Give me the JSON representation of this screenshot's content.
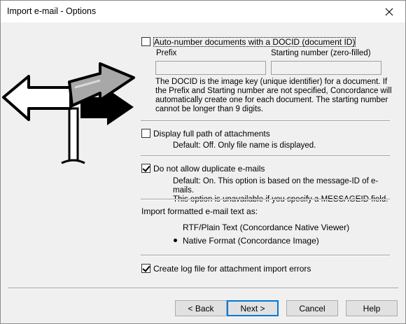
{
  "window": {
    "title": "Import e-mail - Options"
  },
  "autonumber": {
    "label": "Auto-number documents with a DOCID (document ID)",
    "checked": false,
    "prefix_label": "Prefix",
    "prefix_value": "",
    "start_label": "Starting number (zero-filled)",
    "start_value": "",
    "desc_lines": [
      "The DOCID is the image key (unique identifier) for a document. If",
      "the Prefix and Starting number are not specified, Concordance will",
      "automatically create one for each document. The starting number",
      "cannot be longer than 9 digits."
    ]
  },
  "fullpath": {
    "label": "Display full path of attachments",
    "checked": false,
    "desc": "Default: Off. Only file name is displayed."
  },
  "duplicates": {
    "label": "Do not allow duplicate e-mails",
    "checked": true,
    "desc_lines": [
      "Default: On. This option is based on the message-ID of e-mails.",
      "This option is unavailable if you specify a MESSAGEID field."
    ]
  },
  "format": {
    "group_label": "Import formatted e-mail text as:",
    "options": [
      {
        "label": "RTF/Plain Text (Concordance Native Viewer)",
        "selected": false
      },
      {
        "label": "Native Format (Concordance Image)",
        "selected": true
      }
    ]
  },
  "logfile": {
    "label": "Create log file for attachment import errors",
    "checked": true
  },
  "buttons": {
    "back": "< Back",
    "next": "Next >",
    "cancel": "Cancel",
    "help": "Help"
  },
  "icons": {
    "close": "close-icon",
    "illustration": "signpost-arrows-icon"
  }
}
